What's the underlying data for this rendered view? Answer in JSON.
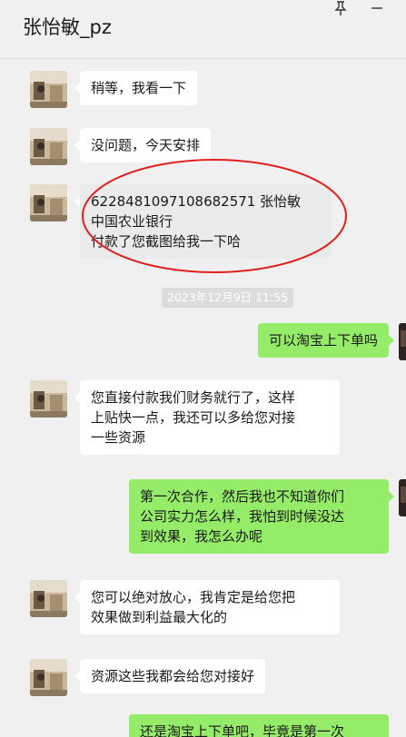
{
  "header": {
    "title": "张怡敏_pz"
  },
  "icons": {
    "pin": "pin-icon",
    "minimize": "minimize-icon"
  },
  "colors": {
    "incoming_bubble": "#ffffff",
    "outgoing_bubble": "#95ec69",
    "background": "#f0f0f0",
    "annotation": "#e02020"
  },
  "timestamp": "2023年12月9日 11:55",
  "messages": [
    {
      "side": "in",
      "text": "稍等，我看一下"
    },
    {
      "side": "in",
      "text": "没问题，今天安排"
    },
    {
      "side": "in",
      "text": "6228481097108682571 张怡敏\n中国农业银行\n付款了您截图给我一下哈"
    },
    {
      "side": "out",
      "text": "可以淘宝上下单吗"
    },
    {
      "side": "in",
      "text": "您直接付款我们财务就行了，这样\n上贴快一点，我还可以多给您对接\n一些资源"
    },
    {
      "side": "out",
      "text": "第一次合作，然后我也不知道你们\n公司实力怎么样，我怕到时候没达\n到效果，我怎么办呢"
    },
    {
      "side": "in",
      "text": "您可以绝对放心，我肯定是给您把\n效果做到利益最大化的"
    },
    {
      "side": "in",
      "text": "资源这些我都会给您对接好"
    },
    {
      "side": "out",
      "text": "还是淘宝上下单吧，毕竟是第一次"
    }
  ]
}
